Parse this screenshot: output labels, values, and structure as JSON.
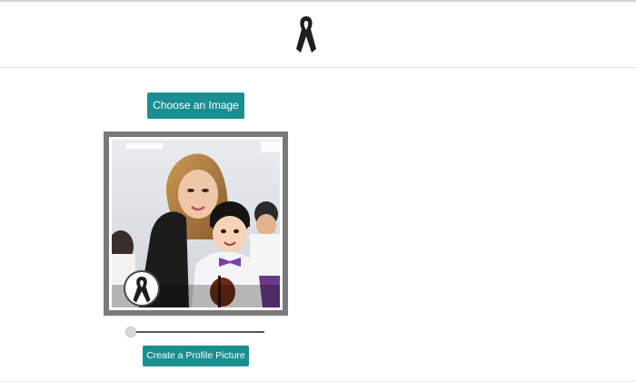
{
  "header": {
    "logo_icon": "black-ribbon-icon"
  },
  "uploader": {
    "choose_label": "Choose an Image"
  },
  "preview": {
    "photo_icon": "profile-photo-image",
    "badge_icon": "black-ribbon-badge-icon"
  },
  "zoom": {
    "slider_value": 0
  },
  "actions": {
    "create_label": "Create a Profile Picture"
  },
  "colors": {
    "accent": "#1a8f91",
    "frame": "#7a7a7a",
    "ribbon": "#1e1e1e"
  }
}
